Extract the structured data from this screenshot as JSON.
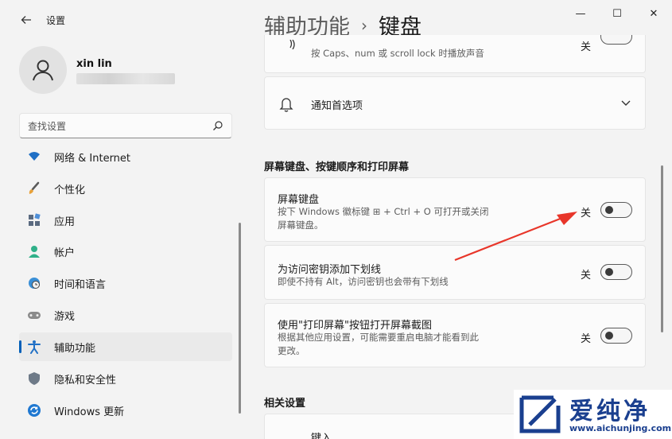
{
  "window": {
    "app_title": "设置",
    "controls": {
      "minimize": "—",
      "maximize": "☐",
      "close": "✕"
    }
  },
  "account": {
    "user_name": "xin lin"
  },
  "search": {
    "placeholder": "查找设置"
  },
  "sidebar": {
    "items": [
      {
        "label": "网络 & Internet",
        "icon": "wifi-icon"
      },
      {
        "label": "个性化",
        "icon": "brush-icon"
      },
      {
        "label": "应用",
        "icon": "apps-icon"
      },
      {
        "label": "帐户",
        "icon": "account-icon"
      },
      {
        "label": "时间和语言",
        "icon": "globe-clock-icon"
      },
      {
        "label": "游戏",
        "icon": "gamepad-icon"
      },
      {
        "label": "辅助功能",
        "icon": "accessibility-icon",
        "active": true
      },
      {
        "label": "隐私和安全性",
        "icon": "shield-icon"
      },
      {
        "label": "Windows 更新",
        "icon": "update-icon"
      }
    ]
  },
  "header": {
    "breadcrumb_parent": "辅助功能",
    "breadcrumb_sep": "›",
    "breadcrumb_current": "键盘"
  },
  "main": {
    "partial_card": {
      "desc": "按 Caps、num 或 scroll lock 时播放声音",
      "state": "关"
    },
    "notifications_card": {
      "title": "通知首选项"
    },
    "section1_title": "屏幕键盘、按键顺序和打印屏幕",
    "settings": [
      {
        "title": "屏幕键盘",
        "desc_line1": "按下 Windows 徽标键 ⊞ + Ctrl + O 可打开或关闭",
        "desc_line2": "屏幕键盘。",
        "state": "关"
      },
      {
        "title": "为访问密钥添加下划线",
        "desc_line1": "即使不持有 Alt，访问密钥也会带有下划线",
        "state": "关"
      },
      {
        "title": "使用\"打印屏幕\"按钮打开屏幕截图",
        "desc_line1": "根据其他应用设置，可能需要重启电脑才能看到此",
        "desc_line2": "更改。",
        "state": "关"
      }
    ],
    "section2_title": "相关设置",
    "related_partial": "键入"
  },
  "watermark": {
    "brand": "爱纯净",
    "url": "www.aichunjing.com"
  },
  "colors": {
    "accent": "#005fb8",
    "annotation": "#e8362a"
  }
}
